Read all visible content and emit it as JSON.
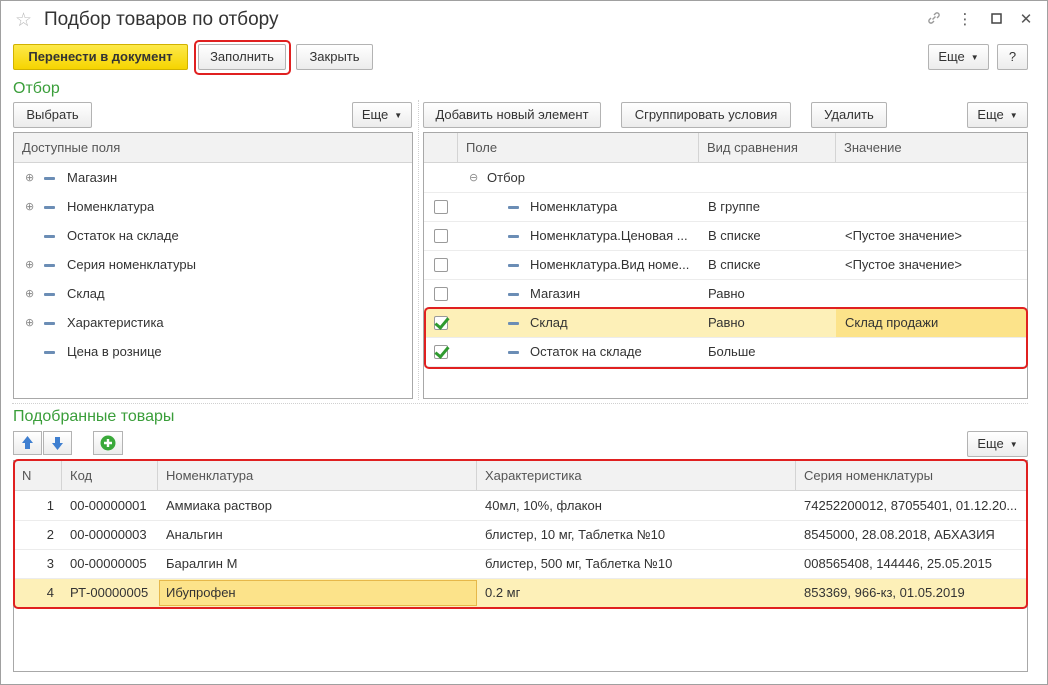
{
  "window": {
    "title": "Подбор товаров по отбору",
    "icons": [
      "star-icon",
      "link-icon",
      "more-vertical-icon",
      "maximize-icon",
      "close-icon"
    ]
  },
  "toolbar": {
    "transfer_label": "Перенести в документ",
    "fill_label": "Заполнить",
    "close_label": "Закрыть",
    "more_label": "Еще",
    "help_label": "?"
  },
  "filter": {
    "section_title": "Отбор",
    "select_label": "Выбрать",
    "left_more_label": "Еще",
    "add_label": "Добавить новый элемент",
    "group_label": "Сгруппировать условия",
    "delete_label": "Удалить",
    "right_more_label": "Еще",
    "available_fields_header": "Доступные поля",
    "available_fields": [
      {
        "label": "Магазин",
        "expandable": true
      },
      {
        "label": "Номенклатура",
        "expandable": true
      },
      {
        "label": "Остаток на складе",
        "expandable": false
      },
      {
        "label": "Серия номенклатуры",
        "expandable": true
      },
      {
        "label": "Склад",
        "expandable": true
      },
      {
        "label": "Характеристика",
        "expandable": true
      },
      {
        "label": "Цена в рознице",
        "expandable": false
      }
    ],
    "columns": {
      "field": "Поле",
      "comparison": "Вид сравнения",
      "value": "Значение"
    },
    "root_label": "Отбор",
    "conditions": [
      {
        "checked": false,
        "field": "Номенклатура",
        "comparison": "В группе",
        "value": ""
      },
      {
        "checked": false,
        "field": "Номенклатура.Ценовая ...",
        "comparison": "В списке",
        "value": "<Пустое значение>"
      },
      {
        "checked": false,
        "field": "Номенклатура.Вид номе...",
        "comparison": "В списке",
        "value": "<Пустое значение>"
      },
      {
        "checked": false,
        "field": "Магазин",
        "comparison": "Равно",
        "value": ""
      },
      {
        "checked": true,
        "field": "Склад",
        "comparison": "Равно",
        "value": "Склад продажи"
      },
      {
        "checked": true,
        "field": "Остаток на складе",
        "comparison": "Больше",
        "value": ""
      }
    ]
  },
  "selected": {
    "section_title": "Подобранные товары",
    "more_label": "Еще",
    "columns": {
      "n": "N",
      "code": "Код",
      "item": "Номенклатура",
      "characteristic": "Характеристика",
      "series": "Серия номенклатуры"
    },
    "rows": [
      {
        "n": "1",
        "code": "00-00000001",
        "item": "Аммиака раствор",
        "characteristic": "40мл, 10%, флакон",
        "series": "74252200012, 87055401, 01.12.20..."
      },
      {
        "n": "2",
        "code": "00-00000003",
        "item": "Анальгин",
        "characteristic": "блистер, 10 мг, Таблетка №10",
        "series": "8545000, 28.08.2018, АБХАЗИЯ"
      },
      {
        "n": "3",
        "code": "00-00000005",
        "item": "Баралгин М",
        "characteristic": "блистер, 500 мг, Таблетка №10",
        "series": "008565408, 144446, 25.05.2015"
      },
      {
        "n": "4",
        "code": "РТ-00000005",
        "item": "Ибупрофен",
        "characteristic": "0.2 мг",
        "series": "853369, 966-кз, 01.05.2019"
      }
    ]
  },
  "colors": {
    "accent_green": "#3a9e3a",
    "primary_yellow": "#f6d400",
    "highlight_red": "#e02020",
    "selection": "#fdf0b8"
  }
}
